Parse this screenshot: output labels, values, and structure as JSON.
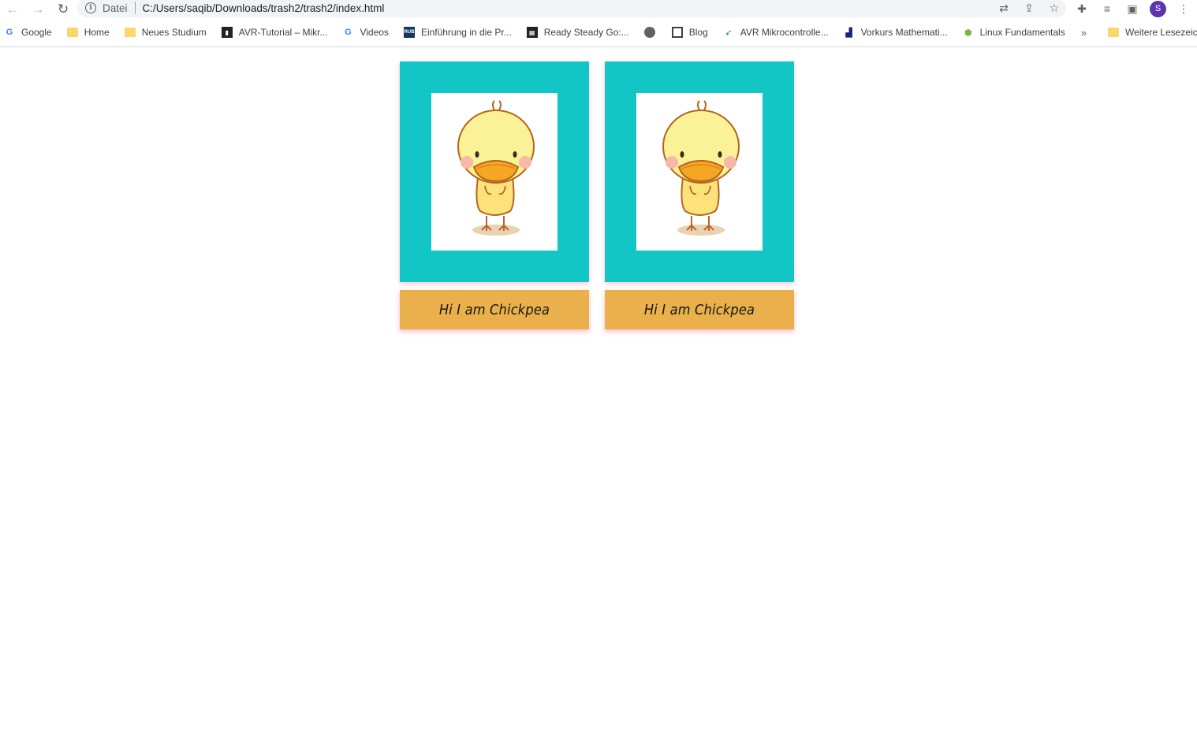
{
  "browser": {
    "address": {
      "scheme_label": "Datei",
      "url": "C:/Users/saqib/Downloads/trash2/trash2/index.html"
    },
    "profile_initial": "S",
    "bookmarks": [
      {
        "label": "Google",
        "icon": "google-icon"
      },
      {
        "label": "Home",
        "icon": "folder-icon"
      },
      {
        "label": "Neues Studium",
        "icon": "folder-icon"
      },
      {
        "label": "AVR-Tutorial – Mikr...",
        "icon": "chip-icon"
      },
      {
        "label": "Videos",
        "icon": "google-icon"
      },
      {
        "label": "Einführung in die Pr...",
        "icon": "rub-icon"
      },
      {
        "label": "Ready Steady Go:...",
        "icon": "site-icon"
      },
      {
        "label": "",
        "icon": "globe-icon"
      },
      {
        "label": "Blog",
        "icon": "blog-icon"
      },
      {
        "label": "AVR Mikrocontrolle...",
        "icon": "avr-icon"
      },
      {
        "label": "Vorkurs Mathemati...",
        "icon": "vorkurs-icon"
      },
      {
        "label": "Linux Fundamentals",
        "icon": "linux-icon"
      }
    ],
    "more_bookmarks_glyph": "»",
    "other_bookmarks_label": "Weitere Lesezeichen"
  },
  "cards": [
    {
      "caption": "Hi I am Chickpea"
    },
    {
      "caption": "Hi I am Chickpea"
    }
  ],
  "colors": {
    "card_frame": "#13c6c6",
    "caption_bg": "#e9b04c",
    "shadow": "#f08096"
  }
}
